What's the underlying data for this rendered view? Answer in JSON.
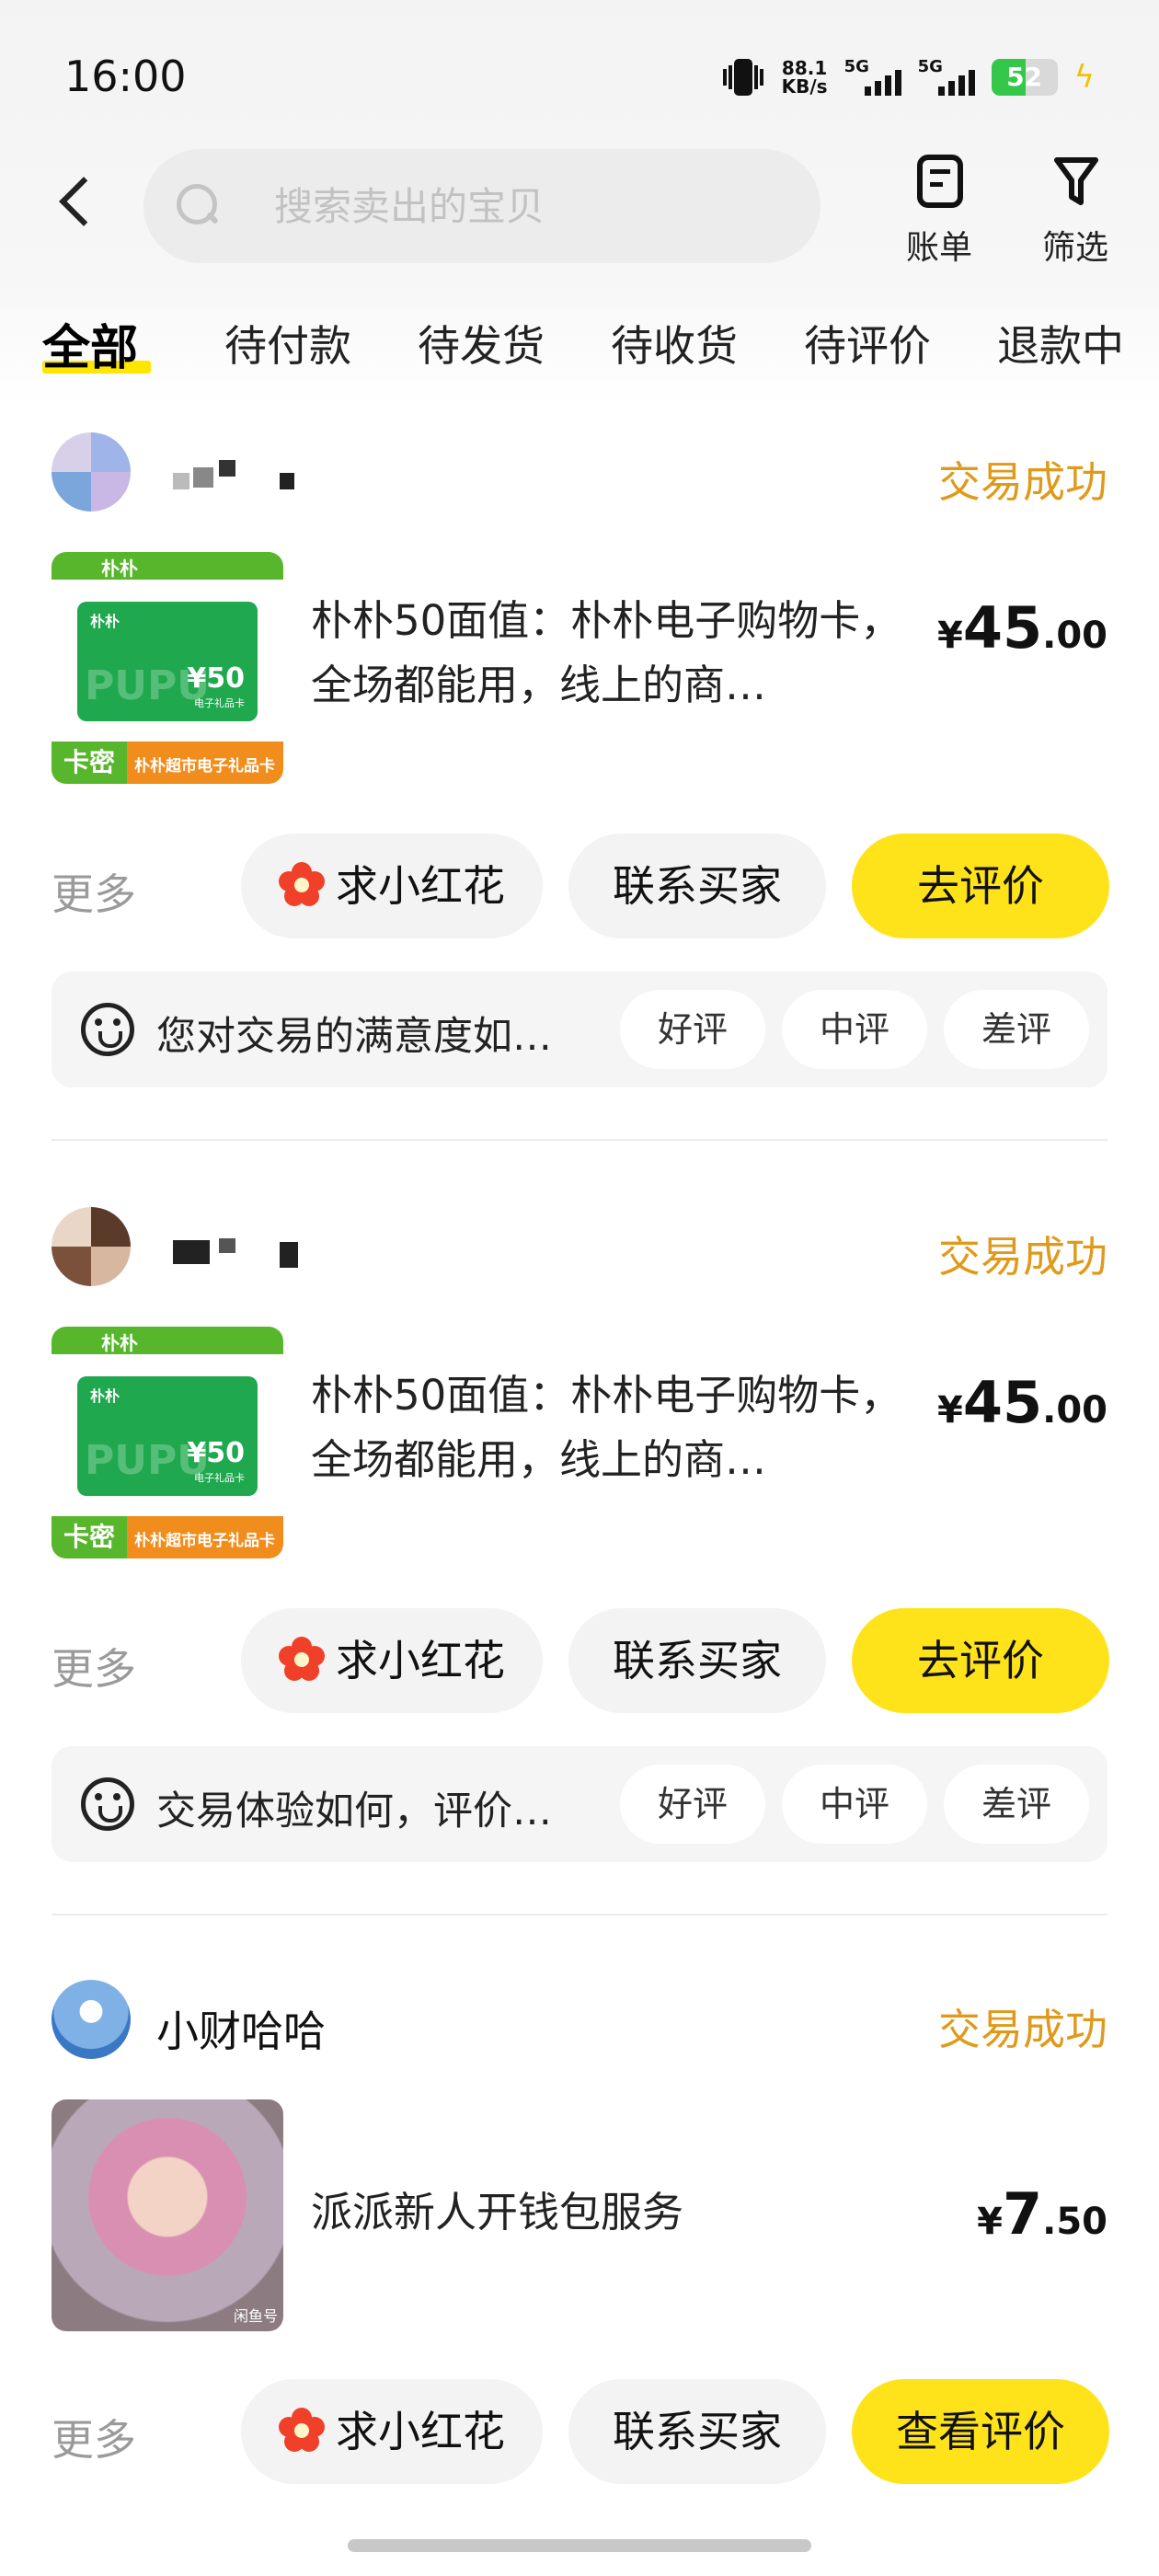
{
  "status_bar": {
    "time": "16:00",
    "net_speed_value": "88.1",
    "net_speed_unit": "KB/s",
    "sim1": "5G",
    "sim2": "5G",
    "battery": "52",
    "battery_level_percent": 52
  },
  "header": {
    "search_placeholder": "搜索卖出的宝贝",
    "bill_label": "账单",
    "filter_label": "筛选"
  },
  "tabs": [
    {
      "label": "全部",
      "active": true
    },
    {
      "label": "待付款"
    },
    {
      "label": "待发货"
    },
    {
      "label": "待收货"
    },
    {
      "label": "待评价"
    },
    {
      "label": "退款中"
    }
  ],
  "orders": [
    {
      "seller": "",
      "status": "交易成功",
      "title": "朴朴50面值：朴朴电子购物卡，全场都能用，线上的商…",
      "price": {
        "currency": "¥",
        "integer": "45",
        "decimal": ".00"
      },
      "thumb": {
        "brand": "朴朴",
        "value": "¥50",
        "sub": "电子礼品卡",
        "watermark": "PUPU",
        "tag": "卡密",
        "desc": "朴朴超市电子礼品卡"
      },
      "more": "更多",
      "flower_btn": "求小红花",
      "contact_btn": "联系买家",
      "primary_btn": "去评价",
      "review_question": "您对交易的满意度如…",
      "rate_good": "好评",
      "rate_mid": "中评",
      "rate_bad": "差评"
    },
    {
      "seller": "",
      "status": "交易成功",
      "title": "朴朴50面值：朴朴电子购物卡，全场都能用，线上的商…",
      "price": {
        "currency": "¥",
        "integer": "45",
        "decimal": ".00"
      },
      "thumb": {
        "brand": "朴朴",
        "value": "¥50",
        "sub": "电子礼品卡",
        "watermark": "PUPU",
        "tag": "卡密",
        "desc": "朴朴超市电子礼品卡"
      },
      "more": "更多",
      "flower_btn": "求小红花",
      "contact_btn": "联系买家",
      "primary_btn": "去评价",
      "review_question": "交易体验如何，评价…",
      "rate_good": "好评",
      "rate_mid": "中评",
      "rate_bad": "差评"
    },
    {
      "seller": "小财哈哈",
      "status": "交易成功",
      "title": "派派新人开钱包服务",
      "price": {
        "currency": "¥",
        "integer": "7",
        "decimal": ".50"
      },
      "thumb_watermark": "闲鱼号",
      "more": "更多",
      "flower_btn": "求小红花",
      "contact_btn": "联系买家",
      "primary_btn": "查看评价"
    }
  ]
}
